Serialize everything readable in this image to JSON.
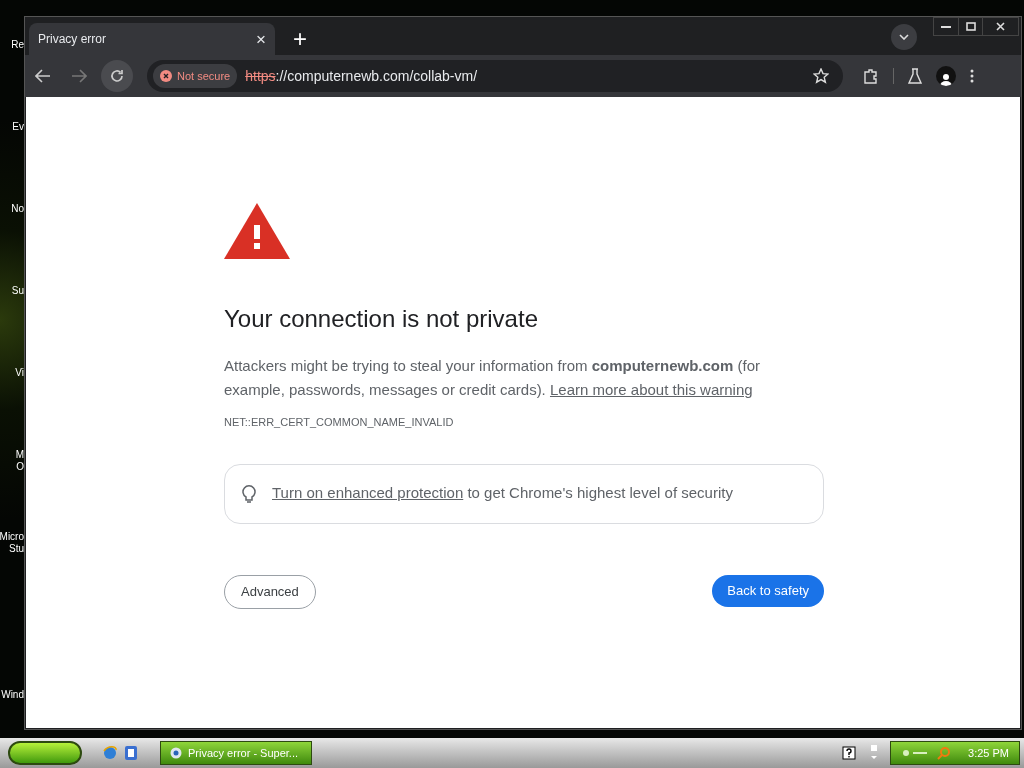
{
  "desktop_icons": [
    {
      "lines": [
        "Re"
      ]
    },
    {
      "lines": [
        "Ev"
      ]
    },
    {
      "lines": [
        "No"
      ]
    },
    {
      "lines": [
        "Su"
      ]
    },
    {
      "lines": [
        "Vi"
      ]
    },
    {
      "lines": [
        "M",
        "O"
      ]
    },
    {
      "lines": [
        "Micro",
        "Stu"
      ]
    },
    {
      "lines": [
        "Wind"
      ]
    }
  ],
  "browser": {
    "tab": {
      "title": "Privacy error",
      "close": "×"
    },
    "new_tab": "+",
    "address": {
      "security_label": "Not secure",
      "scheme": "https",
      "rest": "://computernewb.com/collab-vm/"
    }
  },
  "page": {
    "heading": "Your connection is not private",
    "message": "Attackers might be trying to steal your information from **computernewb.com** (for example, passwords, messages or credit cards).",
    "learn_more": "Learn more about this warning",
    "error_code": "NET::ERR_CERT_COMMON_NAME_INVALID",
    "protection_link": "Turn on enhanced protection",
    "protection_text": "to get Chrome's highest level of security",
    "advanced_button": "Advanced",
    "safety_button": "Back to safety"
  },
  "taskbar": {
    "task": "Privacy error - Super...",
    "clock": "3:25 PM"
  }
}
